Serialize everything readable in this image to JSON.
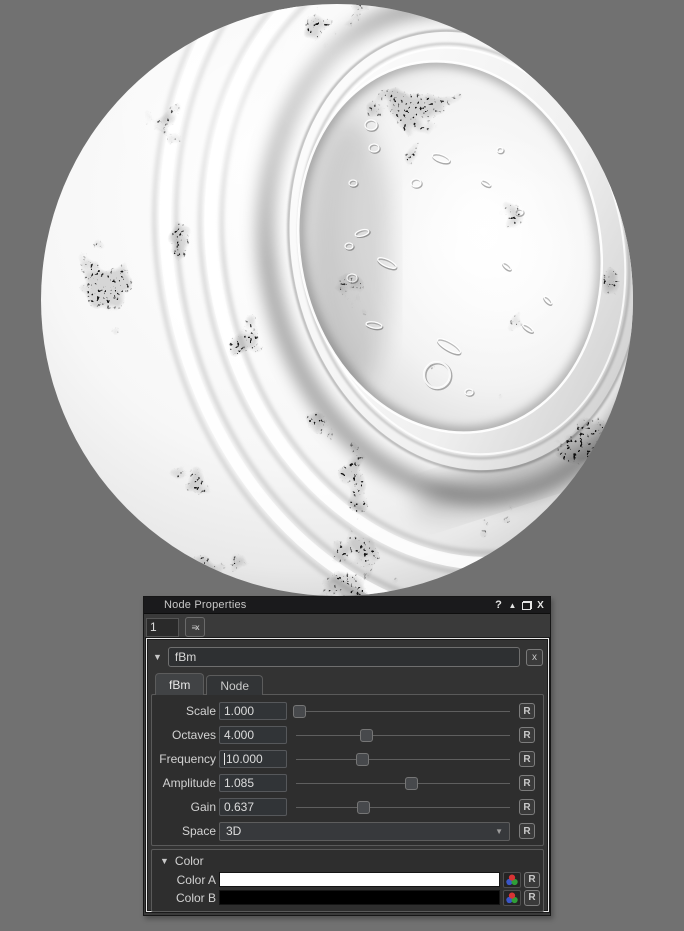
{
  "colors": {
    "canvas_bg": "#717171",
    "panel_bg": "#3a3a3a",
    "titlebar_bg": "#1a1a1c",
    "selection_border": "#e9e9e9",
    "color_a": "#ffffff",
    "color_b": "#000000"
  },
  "titlebar": {
    "title": "Node Properties",
    "icons": [
      {
        "name": "help-icon",
        "glyph": "?"
      },
      {
        "name": "collapse-icon",
        "glyph": "▲"
      },
      {
        "name": "restore-icon",
        "glyph": ""
      },
      {
        "name": "close-icon",
        "glyph": "X"
      }
    ]
  },
  "toolbar": {
    "node_index": "1",
    "expression_button_glyph": "≡x"
  },
  "node": {
    "collapse_glyph": "▼",
    "title": "fBm",
    "close_label": "x",
    "tabs": [
      {
        "label": "fBm",
        "active": true
      },
      {
        "label": "Node",
        "active": false
      }
    ],
    "params": [
      {
        "label": "Scale",
        "value": "1.000",
        "slider_pos": 0.02,
        "reset_label": "R",
        "has_caret": false
      },
      {
        "label": "Octaves",
        "value": "4.000",
        "slider_pos": 0.33,
        "reset_label": "R",
        "has_caret": false
      },
      {
        "label": "Frequency",
        "value": "10.000",
        "slider_pos": 0.315,
        "reset_label": "R",
        "has_caret": true
      },
      {
        "label": "Amplitude",
        "value": "1.085",
        "slider_pos": 0.54,
        "reset_label": "R",
        "has_caret": false
      },
      {
        "label": "Gain",
        "value": "0.637",
        "slider_pos": 0.32,
        "reset_label": "R",
        "has_caret": false
      }
    ],
    "space": {
      "label": "Space",
      "value": "3D",
      "dropdown_glyph": "▼",
      "reset_label": "R"
    },
    "color_group": {
      "collapse_glyph": "▼",
      "header": "Color",
      "rows": [
        {
          "label": "Color A",
          "swatch": "#ffffff",
          "reset_label": "R"
        },
        {
          "label": "Color B",
          "swatch": "#000000",
          "reset_label": "R"
        }
      ]
    }
  }
}
